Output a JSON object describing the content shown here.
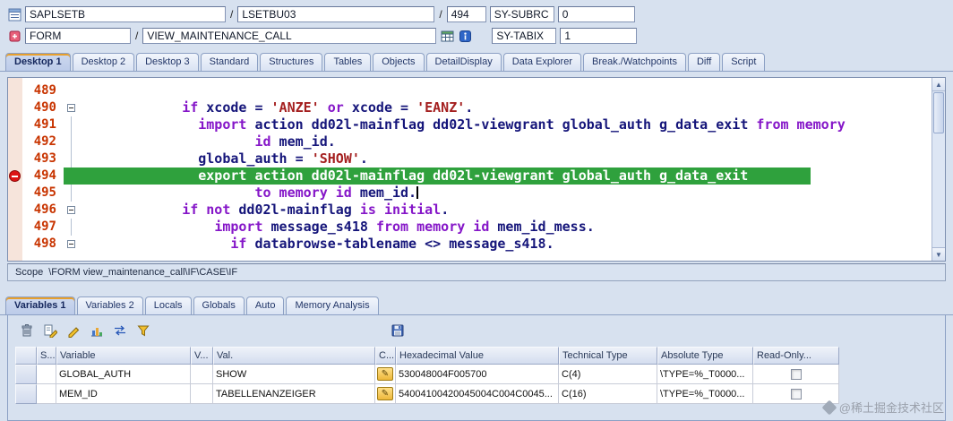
{
  "header": {
    "sep": "/",
    "row1": {
      "program": "SAPLSETB",
      "include": "LSETBU03",
      "line": "494",
      "watch1_name": "SY-SUBRC",
      "watch1_value": "0"
    },
    "row2": {
      "event_type": "FORM",
      "event_name": "VIEW_MAINTENANCE_CALL",
      "watch2_name": "SY-TABIX",
      "watch2_value": "1"
    }
  },
  "desktop_tabs": {
    "active": 0,
    "items": [
      "Desktop 1",
      "Desktop 2",
      "Desktop 3",
      "Standard",
      "Structures",
      "Tables",
      "Objects",
      "DetailDisplay",
      "Data Explorer",
      "Break./Watchpoints",
      "Diff",
      "Script"
    ]
  },
  "editor": {
    "lines": [
      {
        "n": "489",
        "seg": []
      },
      {
        "n": "490",
        "fold": true,
        "seg": [
          [
            "c",
            "      "
          ],
          [
            "k",
            "if"
          ],
          [
            "c",
            " xcode = "
          ],
          [
            "s",
            "'ANZE'"
          ],
          [
            "c",
            " "
          ],
          [
            "k",
            "or"
          ],
          [
            "c",
            " xcode = "
          ],
          [
            "s",
            "'EANZ'"
          ],
          [
            "c",
            "."
          ]
        ]
      },
      {
        "n": "491",
        "fl": true,
        "seg": [
          [
            "c",
            "        "
          ],
          [
            "k",
            "import"
          ],
          [
            "c",
            " action dd02l-mainflag dd02l-viewgrant global_auth g_data_exit "
          ],
          [
            "k",
            "from memory"
          ]
        ]
      },
      {
        "n": "492",
        "fl": true,
        "seg": [
          [
            "c",
            "               "
          ],
          [
            "k",
            "id"
          ],
          [
            "c",
            " mem_id."
          ]
        ]
      },
      {
        "n": "493",
        "fl": true,
        "seg": [
          [
            "c",
            "        global_auth = "
          ],
          [
            "s",
            "'SHOW'"
          ],
          [
            "c",
            "."
          ]
        ]
      },
      {
        "n": "494",
        "bp": true,
        "cur": true,
        "seg": [
          [
            "w",
            "        export action dd02l-mainflag dd02l-viewgrant global_auth g_data_exit"
          ]
        ]
      },
      {
        "n": "495",
        "fl": true,
        "caret": true,
        "seg": [
          [
            "c",
            "               "
          ],
          [
            "k",
            "to memory id"
          ],
          [
            "c",
            " mem_id."
          ]
        ]
      },
      {
        "n": "496",
        "fold": true,
        "seg": [
          [
            "c",
            "      "
          ],
          [
            "k",
            "if not"
          ],
          [
            "c",
            " dd02l-mainflag "
          ],
          [
            "k",
            "is initial"
          ],
          [
            "c",
            "."
          ]
        ]
      },
      {
        "n": "497",
        "fl": true,
        "seg": [
          [
            "c",
            "          "
          ],
          [
            "k",
            "import"
          ],
          [
            "c",
            " message_s418 "
          ],
          [
            "k",
            "from memory id"
          ],
          [
            "c",
            " mem_id_mess."
          ]
        ]
      },
      {
        "n": "498",
        "fold": true,
        "seg": [
          [
            "c",
            "            "
          ],
          [
            "k",
            "if"
          ],
          [
            "c",
            " databrowse-tablename <> message_s418."
          ]
        ]
      }
    ]
  },
  "scope": {
    "label": "Scope",
    "path": "\\FORM view_maintenance_call\\IF\\CASE\\IF"
  },
  "lower_tabs": {
    "active": 0,
    "items": [
      "Variables 1",
      "Variables 2",
      "Locals",
      "Globals",
      "Auto",
      "Memory Analysis"
    ]
  },
  "toolbar": {
    "icons": [
      "delete-icon",
      "change-entry-icon",
      "pencil-icon",
      "chart-icon",
      "swap-icon",
      "filter-icon",
      "save-icon"
    ]
  },
  "variables_table": {
    "columns": [
      "",
      "S...",
      "Variable",
      "V...",
      "Val.",
      "C...",
      "Hexadecimal Value",
      "Technical Type",
      "Absolute Type",
      "Read-Only..."
    ],
    "rows": [
      {
        "variable": "GLOBAL_AUTH",
        "val": "SHOW",
        "hex": "530048004F005700",
        "technical_type": "C(4)",
        "absolute_type": "\\TYPE=%_T0000...",
        "read_only": false
      },
      {
        "variable": "MEM_ID",
        "val": "TABELLENANZEIGER",
        "hex": "54004100420045004C004C0045...",
        "technical_type": "C(16)",
        "absolute_type": "\\TYPE=%_T0000...",
        "read_only": false
      }
    ]
  },
  "watermark": "@稀土掘金技术社区"
}
